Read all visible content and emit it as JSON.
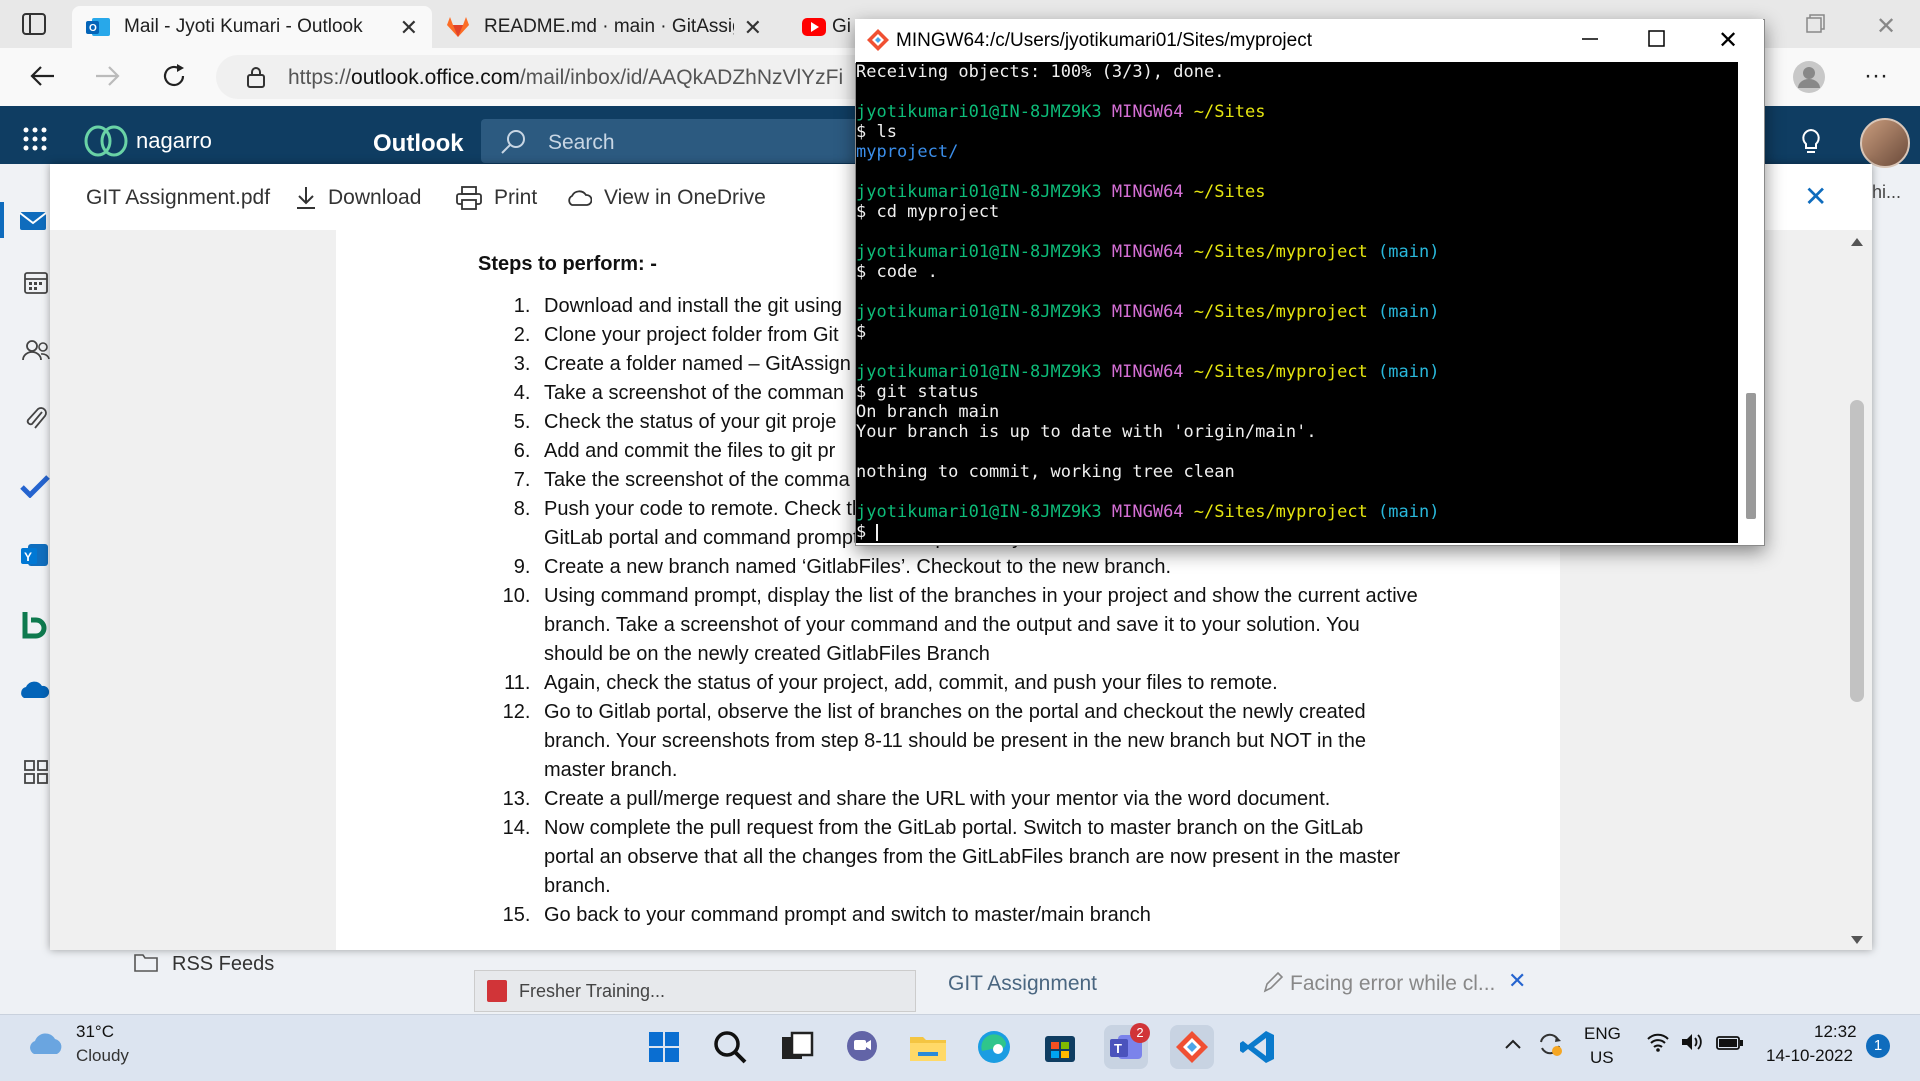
{
  "browser": {
    "tabs": [
      {
        "label": "Mail - Jyoti Kumari - Outlook",
        "active": true
      },
      {
        "label": "README.md · main · GitAssignme",
        "active": false
      },
      {
        "label": "Gi",
        "active": false
      }
    ],
    "url_prefix": "https://",
    "url_domain": "outlook.office.com",
    "url_path": "/mail/inbox/id/AAQkADZhNzVlYzFi"
  },
  "outlook": {
    "brand": "nagarro",
    "app_title": "Outlook",
    "search_placeholder": "Search",
    "profile_name_partial": "hi..."
  },
  "viewer": {
    "file_name": "GIT Assignment.pdf",
    "download_label": "Download",
    "print_label": "Print",
    "onedrive_label": "View in OneDrive"
  },
  "document": {
    "steps_heading": "Steps to perform: -",
    "steps": [
      "Download and install the git using",
      "Clone your project folder from Git",
      "Create a folder named – GitAssign",
      "Take a screenshot of the comman",
      "Check the status of your git proje",
      "Add and commit the files to git pr",
      "Take the screenshot of the comma commit commands.",
      "Push your code to remote. Check the status of your project on GitLab. Take screenshots of your GitLab portal and command prompt and keep it handy.",
      "Create a new branch named ‘GitlabFiles’. Checkout to the new branch.",
      "Using command prompt, display the list of the branches in your project and show the current active branch. Take a screenshot of your command and the output and save it to your solution. You should be on the newly created GitlabFiles Branch",
      "Again, check the status of your project, add, commit, and push your files to remote.",
      "Go to Gitlab portal, observe the list of branches on the portal and checkout the newly created branch. Your screenshots from step 8-11 should be present in the new branch but NOT in the master branch.",
      "Create a pull/merge request and share the URL with your mentor via the word document.",
      "Now complete the pull request from the GitLab portal. Switch to master branch on the GitLab portal an observe that all the changes from the GitLabFiles branch are now present in the master branch.",
      "Go back to your command prompt and switch to master/main branch"
    ]
  },
  "terminal": {
    "title": "MINGW64:/c/Users/jyotikumari01/Sites/myproject",
    "prompt_user": "jyotikumari01@IN-8JMZ9K3",
    "prompt_env": "MINGW64",
    "lines": {
      "receiving": "Receiving objects: 100% (3/3), done.",
      "path_sites": "~/Sites",
      "path_project": "~/Sites/myproject",
      "branch": "(main)",
      "cmd_ls": "$ ls",
      "out_ls": "myproject/",
      "cmd_cd": "$ cd myproject",
      "cmd_code": "$ code .",
      "prompt_empty": "$",
      "cmd_status": "$ git status",
      "out_status1": "On branch main",
      "out_status2": "Your branch is up to date with 'origin/main'.",
      "out_status3": "nothing to commit, working tree clean",
      "prompt_last": "$ "
    }
  },
  "background": {
    "rss": "RSS Feeds",
    "attachment": "Fresher Training...",
    "mail_subject": "GIT Assignment",
    "draft_subject": "Facing error while cl..."
  },
  "taskbar": {
    "weather_temp": "31°C",
    "weather_desc": "Cloudy",
    "lang1": "ENG",
    "lang2": "US",
    "time": "12:32",
    "date": "14-10-2022",
    "notif_count": "1",
    "teams_badge": "2"
  },
  "colors": {
    "outlook_header": "#0f3d62",
    "term_green": "#0dbc79",
    "term_magenta": "#d670d6",
    "term_yellow": "#e5e510",
    "term_cyan": "#29b8db",
    "taskbar": "#dce4f0"
  }
}
